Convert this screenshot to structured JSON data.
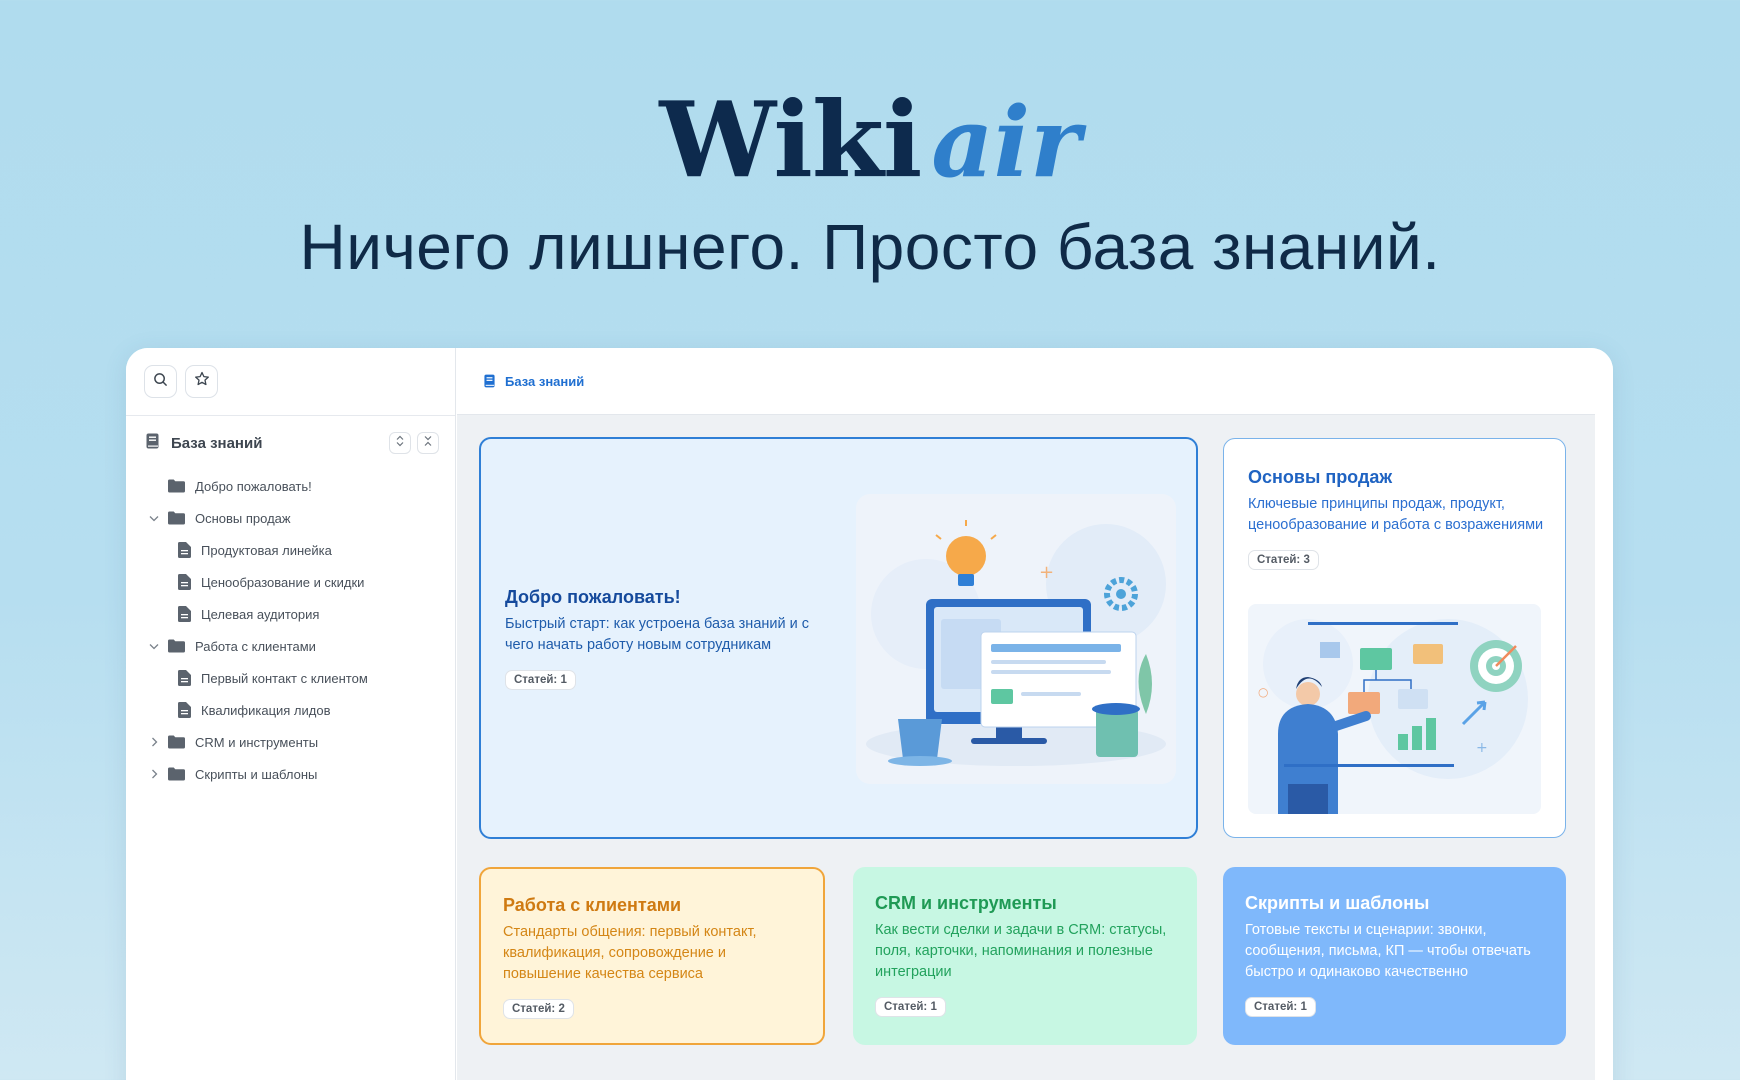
{
  "hero": {
    "logo_wiki": "Wiki",
    "logo_air": "air",
    "tagline": "Ничего лишнего. Просто база знаний."
  },
  "sidebar": {
    "header_title": "База знаний",
    "tree": [
      {
        "label": "Добро пожаловать!",
        "type": "folder",
        "expanded": null
      },
      {
        "label": "Основы продаж",
        "type": "folder",
        "expanded": true
      },
      {
        "label": "Продуктовая линейка",
        "type": "doc"
      },
      {
        "label": "Ценообразование и скидки",
        "type": "doc"
      },
      {
        "label": "Целевая аудитория",
        "type": "doc"
      },
      {
        "label": "Работа с клиентами",
        "type": "folder",
        "expanded": true
      },
      {
        "label": "Первый контакт с клиентом",
        "type": "doc"
      },
      {
        "label": "Квалификация лидов",
        "type": "doc"
      },
      {
        "label": "CRM и инструменты",
        "type": "folder",
        "expanded": false
      },
      {
        "label": "Скрипты и шаблоны",
        "type": "folder",
        "expanded": false
      }
    ]
  },
  "breadcrumb": {
    "label": "База знаний"
  },
  "cards": {
    "welcome": {
      "title": "Добро пожаловать!",
      "description": "Быстрый старт: как устроена база знаний и с чего начать работу новым сотрудникам",
      "badge": "Статей: 1"
    },
    "sales": {
      "title": "Основы продаж",
      "description": "Ключевые принципы продаж, продукт, ценообразование и работа с возражениями",
      "badge": "Статей: 3"
    },
    "clients": {
      "title": "Работа с клиентами",
      "description": "Стандарты общения: первый контакт, квалификация, сопровождение и повышение качества сервиса",
      "badge": "Статей: 2"
    },
    "crm": {
      "title": "CRM и инструменты",
      "description": "Как вести сделки и задачи в CRM: статусы, поля, карточки, напоминания и полезные интеграции",
      "badge": "Статей: 1"
    },
    "scripts": {
      "title": "Скрипты и шаблоны",
      "description": "Готовые тексты и сценарии: звонки, сообщения, письма, КП — чтобы отвечать быстро и одинаково качественно",
      "badge": "Статей: 1"
    }
  },
  "colors": {
    "accent": "#2f7fcb",
    "logo_dark": "#0d2a4d",
    "clients_orange": "#f0a53a",
    "crm_green": "#1f9a55",
    "scripts_blue": "#7fb8fb"
  }
}
